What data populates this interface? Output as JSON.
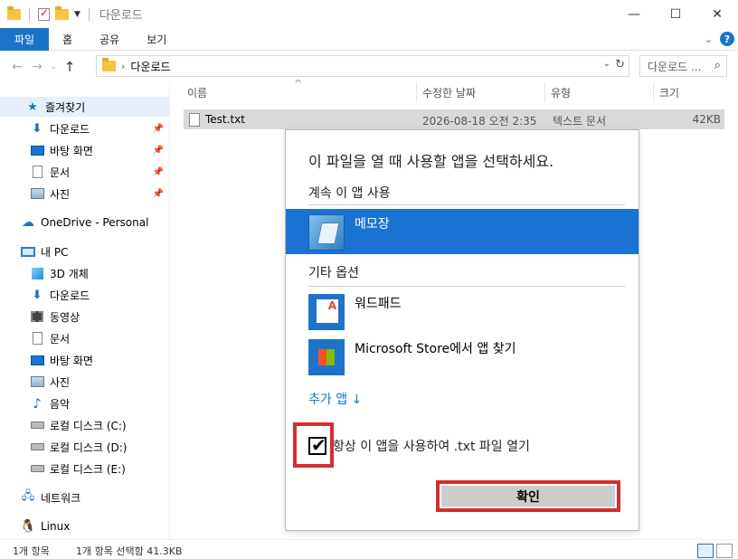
{
  "window": {
    "title": "다운로드",
    "controls": {
      "minimize": "—",
      "maximize": "☐",
      "close": "✕"
    }
  },
  "ribbon": {
    "tabs": [
      "파일",
      "홈",
      "공유",
      "보기"
    ],
    "help": "?"
  },
  "address": {
    "path": "다운로드",
    "search_placeholder": "다운로드 ..."
  },
  "sidebar": {
    "quick_access": "즐겨찾기",
    "quick_items": [
      "다운로드",
      "바탕 화면",
      "문서",
      "사진"
    ],
    "onedrive": "OneDrive - Personal",
    "this_pc": "내 PC",
    "pc_items": [
      "3D 개체",
      "다운로드",
      "동영상",
      "문서",
      "바탕 화면",
      "사진",
      "음악",
      "로컬 디스크 (C:)",
      "로컬 디스크 (D:)",
      "로컬 디스크 (E:)"
    ],
    "network": "네트워크",
    "linux": "Linux"
  },
  "columns": {
    "name": "이름",
    "modified": "수정한 날짜",
    "type": "유형",
    "size": "크기"
  },
  "file": {
    "name": "Test.txt",
    "modified": "2026-08-18 오전 2:35",
    "type": "텍스트 문서",
    "size": "42KB"
  },
  "dialog": {
    "title": "이 파일을 열 때 사용할 앱을 선택하세요.",
    "keep_using": "계속 이 앱 사용",
    "current_app": "메모장",
    "other_options": "기타 옵션",
    "other_apps": [
      "워드패드",
      "Microsoft Store에서 앱 찾기"
    ],
    "more_apps": "추가 앱 ↓",
    "always_use": "항상 이 앱을 사용하여 .txt 파일 열기",
    "always_checked": true,
    "ok": "확인"
  },
  "status": {
    "count": "1개 항목",
    "selected": "1개 항목 선택함 41.3KB"
  }
}
